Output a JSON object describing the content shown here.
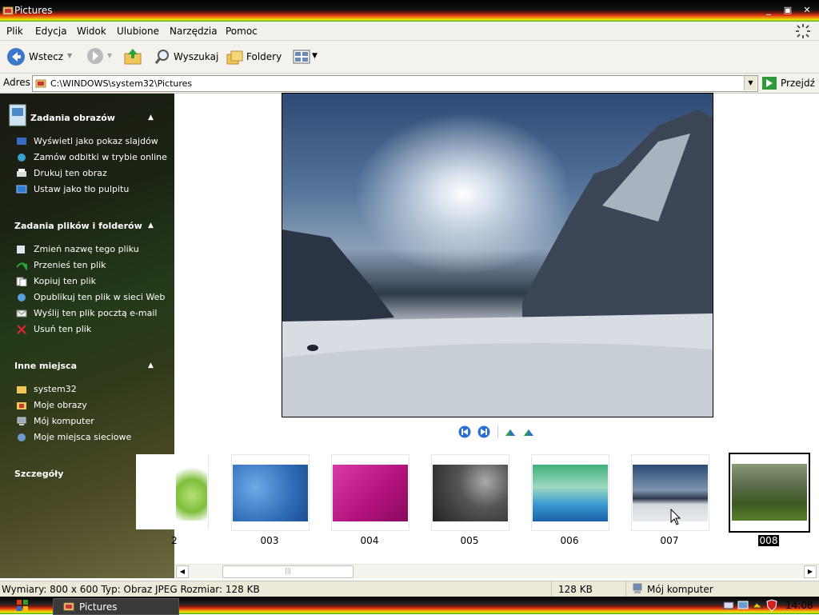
{
  "window": {
    "title": "Pictures"
  },
  "menu": [
    "Plik",
    "Edycja",
    "Widok",
    "Ulubione",
    "Narzędzia",
    "Pomoc"
  ],
  "toolbar": {
    "back": "Wstecz",
    "search": "Wyszukaj",
    "folders": "Foldery"
  },
  "address": {
    "label": "Adres",
    "value": "C:\\WINDOWS\\system32\\Pictures",
    "go": "Przejdź"
  },
  "sidebar": {
    "image_tasks": {
      "title": "Zadania obrazów",
      "items": [
        "Wyświetl jako pokaz slajdów",
        "Zamów odbitki w trybie online",
        "Drukuj ten obraz",
        "Ustaw jako tło pulpitu"
      ]
    },
    "file_tasks": {
      "title": "Zadania plików i folderów",
      "items": [
        "Zmień nazwę tego pliku",
        "Przenieś ten plik",
        "Kopiuj ten plik",
        "Opublikuj ten plik w sieci Web",
        "Wyślij ten plik pocztą e-mail",
        "Usuń ten plik"
      ]
    },
    "other_places": {
      "title": "Inne miejsca",
      "items": [
        "system32",
        "Moje obrazy",
        "Mój komputer",
        "Moje miejsca sieciowe"
      ]
    },
    "details": {
      "title": "Szczegóły"
    }
  },
  "thumbnails": [
    {
      "label": "2"
    },
    {
      "label": "003"
    },
    {
      "label": "004"
    },
    {
      "label": "005"
    },
    {
      "label": "006"
    },
    {
      "label": "007"
    },
    {
      "label": "008"
    }
  ],
  "status": {
    "info": "Wymiary: 800 x 600 Typ: Obraz JPEG Rozmiar: 128 KB",
    "size": "128 KB",
    "zone": "Mój komputer"
  },
  "taskbar": {
    "task": "Pictures",
    "clock": "14:08"
  },
  "colors": {
    "accent_blue": "#2a6fd6",
    "sidebar_text": "#ffffff",
    "selection": "#000000"
  }
}
